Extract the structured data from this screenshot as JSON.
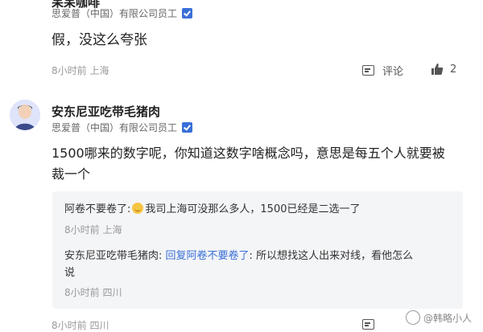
{
  "comment1": {
    "username": "呆呆咖啡",
    "company": "思爱普（中国）有限公司员工",
    "text": "假，没这么夸张",
    "time_location": "8小时前 上海",
    "comment_label": "评论",
    "like_count": "2"
  },
  "comment2": {
    "username": "安东尼亚吃带毛猪肉",
    "company": "思爱普（中国）有限公司员工",
    "text_line1": "1500哪来的数字呢，你知道这数字啥概念吗，意思是每五个人就要被",
    "text_line2": "裁一个",
    "time_location": "8小时前 四川",
    "replies": [
      {
        "author": "阿卷不要卷了",
        "sep": ":",
        "text": "我司上海可没那么多人，1500已经是二选一了",
        "time_location": "8小时前 上海"
      },
      {
        "author": "安东尼亚吃带毛猪肉",
        "sep": ": ",
        "reply_to": "回复阿卷不要卷了",
        "sep2": ": ",
        "text_line1": "所以想找这人出来对线，看他怎么",
        "text_line2": "说",
        "time_location": "8小时前 四川"
      }
    ]
  },
  "watermark": "@韩略小人",
  "colors": {
    "accent": "#3a6fd8",
    "reply_bg": "#f4f5f7",
    "meta": "#999999"
  }
}
